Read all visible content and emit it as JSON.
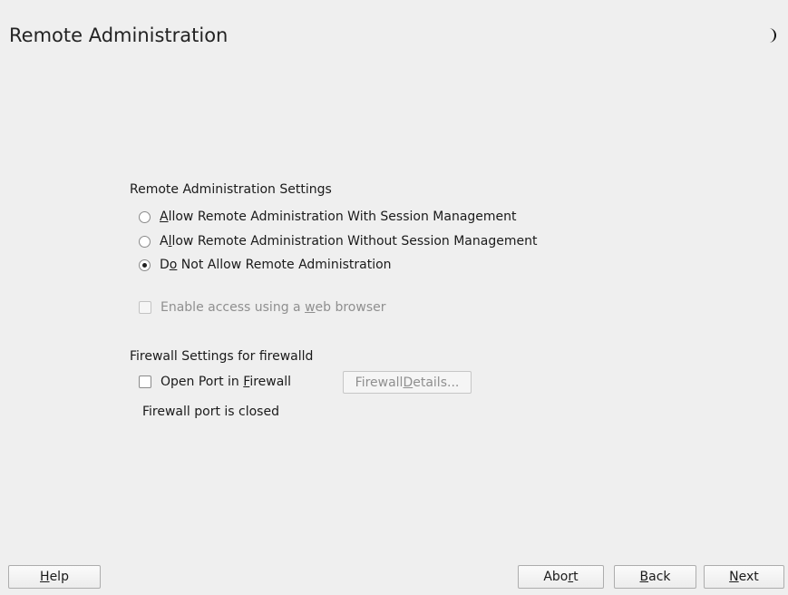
{
  "header": {
    "title": "Remote Administration"
  },
  "remote_admin": {
    "group_label": "Remote Administration Settings",
    "options": [
      {
        "pre": "",
        "key": "A",
        "post": "llow Remote Administration With Session Management",
        "selected": false
      },
      {
        "pre": "A",
        "key": "l",
        "post": "low Remote Administration Without Session Management",
        "selected": false
      },
      {
        "pre": "D",
        "key": "o",
        "post": " Not Allow Remote Administration",
        "selected": true
      }
    ],
    "web_access": {
      "pre": "Enable access using a ",
      "key": "w",
      "post": "eb browser",
      "checked": false,
      "enabled": false
    }
  },
  "firewall": {
    "group_label": "Firewall Settings for firewalld",
    "open_port": {
      "pre": "Open Port in ",
      "key": "F",
      "post": "irewall",
      "checked": false
    },
    "details_button": {
      "pre": "Firewall ",
      "key": "D",
      "post": "etails...",
      "enabled": false
    },
    "status": "Firewall port is closed"
  },
  "footer": {
    "help": {
      "pre": "",
      "key": "H",
      "post": "elp"
    },
    "abort": {
      "pre": "Abo",
      "key": "r",
      "post": "t"
    },
    "back": {
      "pre": "",
      "key": "B",
      "post": "ack"
    },
    "next": {
      "pre": "",
      "key": "N",
      "post": "ext"
    }
  }
}
